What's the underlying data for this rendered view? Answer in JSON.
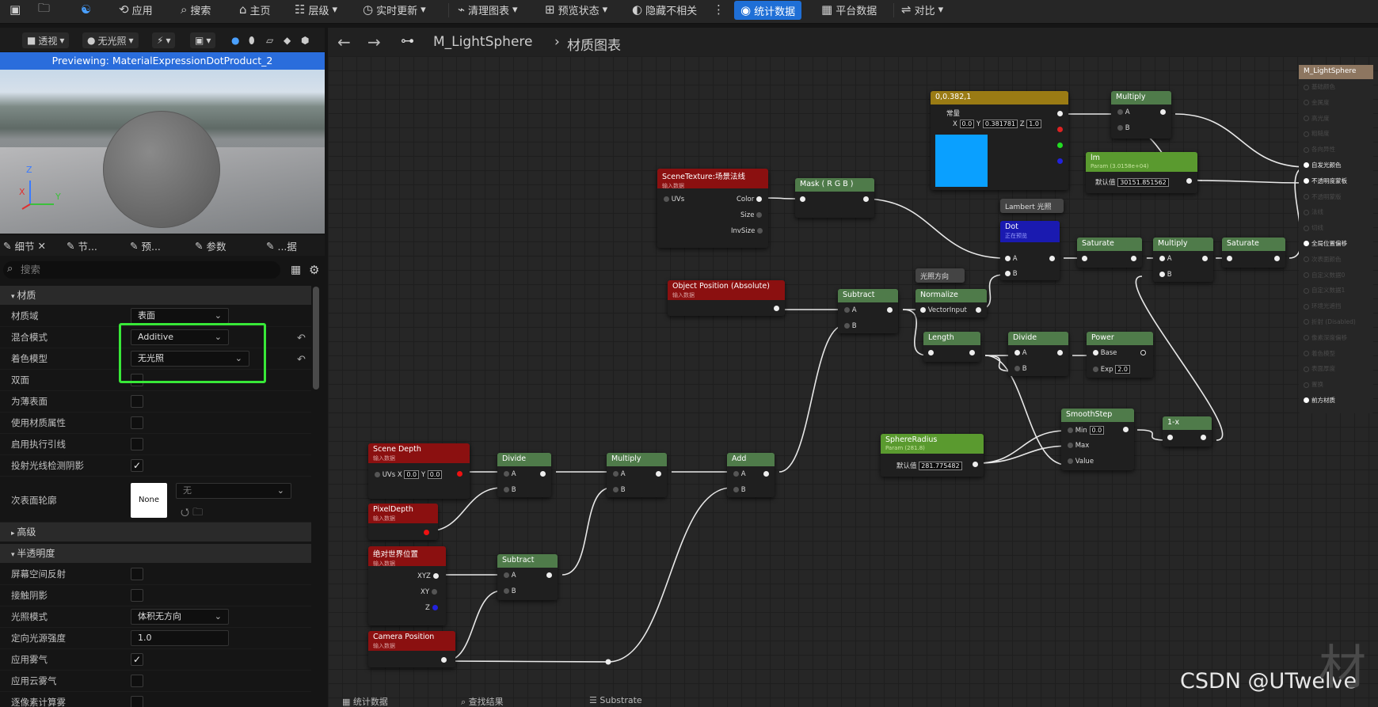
{
  "toolbar": {
    "apply": "应用",
    "search": "搜索",
    "home": "主页",
    "hierarchy": "层级",
    "live_update": "实时更新",
    "clean_graph": "清理图表",
    "preview_state": "预览状态",
    "hide_unrelated": "隐藏不相关",
    "stats": "统计数据",
    "platform_stats": "平台数据",
    "compare": "对比"
  },
  "viewport": {
    "perspective": "透视",
    "unlit": "无光照",
    "previewing": "Previewing: MaterialExpressionDotProduct_2",
    "axis_z": "Z",
    "axis_x": "X",
    "axis_y": "Y"
  },
  "details": {
    "tabs": [
      "细节",
      "节...",
      "预...",
      "参数",
      "...据"
    ],
    "search_placeholder": "搜索",
    "section_material": "材质",
    "rows_material": [
      {
        "label": "材质域",
        "value": "表面"
      },
      {
        "label": "混合模式",
        "value": "Additive"
      },
      {
        "label": "着色模型",
        "value": "无光照"
      },
      {
        "label": "双面",
        "value": ""
      },
      {
        "label": "为薄表面",
        "value": ""
      },
      {
        "label": "使用材质属性",
        "value": ""
      },
      {
        "label": "启用执行引线",
        "value": ""
      },
      {
        "label": "投射光线检测阴影",
        "value": "✓"
      },
      {
        "label": "次表面轮廓",
        "value": "None"
      }
    ],
    "subsurface_none_combo": "无",
    "section_advanced": "高级",
    "section_translucency": "半透明度",
    "rows_translucency": [
      {
        "label": "屏幕空间反射",
        "value": ""
      },
      {
        "label": "接触阴影",
        "value": ""
      },
      {
        "label": "光照模式",
        "value": "体积无方向"
      },
      {
        "label": "定向光源强度",
        "value": "1.0"
      },
      {
        "label": "应用雾气",
        "value": "✓"
      },
      {
        "label": "应用云雾气",
        "value": ""
      },
      {
        "label": "逐像素计算雾",
        "value": ""
      }
    ]
  },
  "graph": {
    "asset": "M_LightSphere",
    "breadcrumb": "材质图表",
    "watermark": "材",
    "csdn": "CSDN @UTwelve",
    "bottom_tabs": [
      "统计数据",
      "查找结果",
      "Substrate"
    ]
  },
  "nodes": {
    "const": {
      "title": "0,0.382,1",
      "label": "常量",
      "x": "0.0",
      "y": "0.381781",
      "z": "1.0",
      "color": "#0aa0ff"
    },
    "multiply1": {
      "title": "Multiply",
      "a": "A",
      "b": "B"
    },
    "lm": {
      "title": "lm",
      "sub": "Param (3.0158e+04)",
      "default_label": "默认值",
      "value": "30151.851562"
    },
    "lambert": {
      "title": "Lambert 光照"
    },
    "dot": {
      "title": "Dot",
      "sub": "正在预览",
      "a": "A",
      "b": "B"
    },
    "scenetex": {
      "title": "SceneTexture:场景法线",
      "sub": "输入数据",
      "uvs": "UVs",
      "color": "Color",
      "size": "Size",
      "invsize": "InvSize"
    },
    "mask": {
      "title": "Mask ( R G B )"
    },
    "light_dir": {
      "title": "光照方向"
    },
    "objpos": {
      "title": "Object Position (Absolute)",
      "sub": "输入数据"
    },
    "subtract1": {
      "title": "Subtract",
      "a": "A",
      "b": "B"
    },
    "normalize": {
      "title": "Normalize",
      "input": "VectorInput"
    },
    "saturate1": {
      "title": "Saturate"
    },
    "multiply2": {
      "title": "Multiply",
      "a": "A",
      "b": "B"
    },
    "saturate2": {
      "title": "Saturate"
    },
    "length": {
      "title": "Length"
    },
    "divide1": {
      "title": "Divide",
      "a": "A",
      "b": "B"
    },
    "power": {
      "title": "Power",
      "base": "Base",
      "exp": "Exp",
      "exp_value": "2.0"
    },
    "smoothstep": {
      "title": "SmoothStep",
      "min": "Min",
      "min_value": "0.0",
      "max": "Max",
      "value": "Value"
    },
    "oneminus": {
      "title": "1-x"
    },
    "sphereradius": {
      "title": "SphereRadius",
      "sub": "Param (281.8)",
      "default_label": "默认值",
      "value": "281.775482"
    },
    "scenedepth": {
      "title": "Scene Depth",
      "sub": "输入数据",
      "uvs": "UVs",
      "x": "0.0",
      "y": "0.0"
    },
    "divide2": {
      "title": "Divide",
      "a": "A",
      "b": "B"
    },
    "multiply3": {
      "title": "Multiply",
      "a": "A",
      "b": "B"
    },
    "add": {
      "title": "Add",
      "a": "A",
      "b": "B"
    },
    "pixeldepth": {
      "title": "PixelDepth",
      "sub": "输入数据"
    },
    "worldpos": {
      "title": "绝对世界位置",
      "sub": "输入数据",
      "xyz": "XYZ",
      "xy": "XY",
      "z": "Z"
    },
    "subtract2": {
      "title": "Subtract",
      "a": "A",
      "b": "B"
    },
    "campos": {
      "title": "Camera Position",
      "sub": "输入数据"
    }
  },
  "material_output": {
    "title": "M_LightSphere",
    "pins": [
      "基础颜色",
      "金属度",
      "高光度",
      "粗糙度",
      "各向异性",
      "自发光颜色",
      "不透明度蒙板",
      "不透明蒙版",
      "法线",
      "切线",
      "全局位置偏移",
      "次表面颜色",
      "自定义数据0",
      "自定义数据1",
      "环境光遮挡",
      "折射 (Disabled)",
      "像素深度偏移",
      "着色模型",
      "表面厚度",
      "置换",
      "前方材质"
    ],
    "active": [
      5,
      6,
      10,
      20
    ]
  }
}
